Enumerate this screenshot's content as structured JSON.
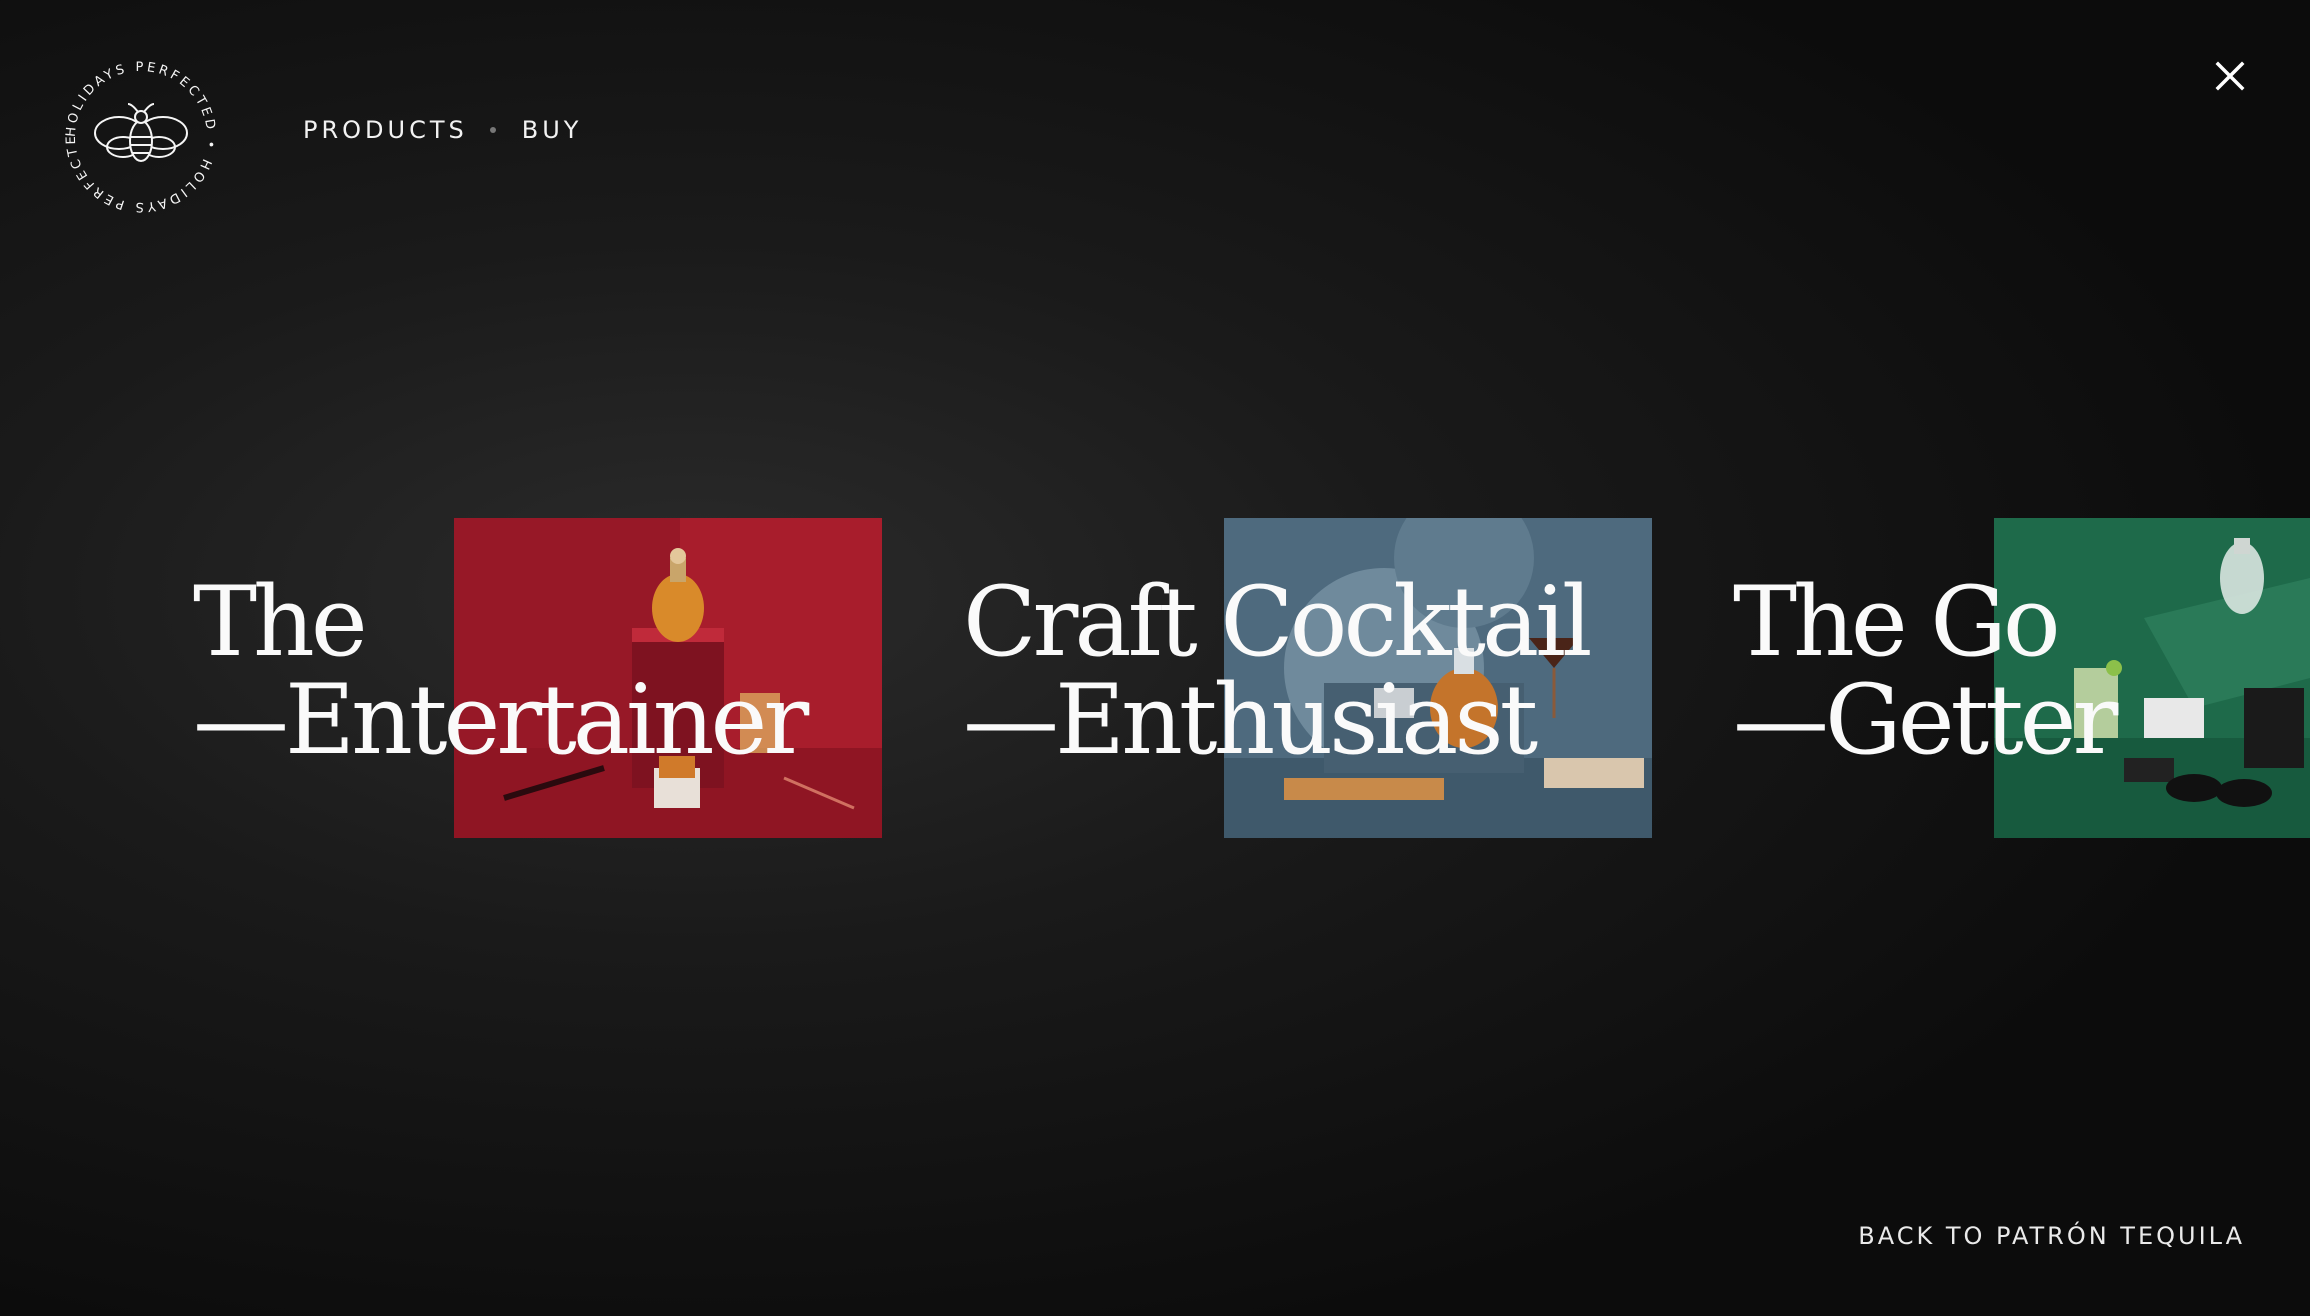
{
  "logo": {
    "ring_text": "HOLIDAYS PERFECTED • HOLIDAYS PERFECTED •",
    "icon": "bee-icon"
  },
  "nav": {
    "products": "PRODUCTS",
    "buy": "BUY"
  },
  "close_icon": "close-icon",
  "cards": [
    {
      "line1": "The",
      "line2": "—Entertainer",
      "photo_color": "#b3202f"
    },
    {
      "line1": "Craft Cocktail",
      "line2": "—Enthusiast",
      "photo_color": "#4f6b80"
    },
    {
      "line1": "The Go",
      "line2": "—Getter",
      "photo_color": "#1e6a4a"
    }
  ],
  "footer": {
    "back_link": "BACK TO PATRÓN TEQUILA"
  }
}
